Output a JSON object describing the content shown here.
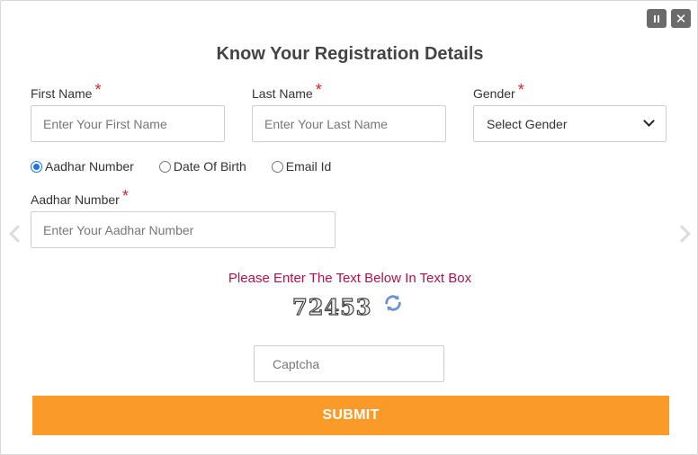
{
  "window": {
    "pause_icon": "pause-icon",
    "close_icon": "close-icon",
    "close_glyph": "✕"
  },
  "title": "Know Your Registration Details",
  "form": {
    "first_name": {
      "label": "First Name",
      "required_mark": "*",
      "placeholder": "Enter Your First Name",
      "value": ""
    },
    "last_name": {
      "label": "Last Name",
      "required_mark": "*",
      "placeholder": "Enter Your Last Name",
      "value": ""
    },
    "gender": {
      "label": "Gender",
      "required_mark": "*",
      "selected": "Select Gender"
    },
    "search_by": {
      "options": [
        {
          "label": "Aadhar Number",
          "checked": true
        },
        {
          "label": "Date Of Birth",
          "checked": false
        },
        {
          "label": "Email Id",
          "checked": false
        }
      ]
    },
    "aadhar": {
      "label": "Aadhar Number",
      "required_mark": "*",
      "placeholder": "Enter Your Aadhar Number",
      "value": ""
    },
    "captcha": {
      "prompt": "Please Enter The Text Below In Text Box",
      "code": "72453",
      "refresh_icon": "refresh-icon",
      "input_placeholder": "Captcha"
    },
    "submit_label": "SUBMIT"
  },
  "colors": {
    "submit": "#fa9a28",
    "prompt": "#b0124b",
    "required": "#d9232d",
    "radio_selected": "#1a73e8",
    "refresh_icon": "#6b8fd6"
  }
}
